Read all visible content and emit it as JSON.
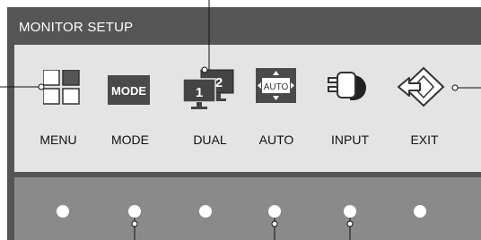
{
  "window": {
    "title": "MONITOR SETUP"
  },
  "menu_items": [
    {
      "label": "MENU",
      "icon": "menu-grid-icon"
    },
    {
      "label": "MODE",
      "icon": "mode-icon",
      "icon_text": "MODE"
    },
    {
      "label": "DUAL",
      "icon": "dual-monitor-icon",
      "icon_text_1": "1",
      "icon_text_2": "2"
    },
    {
      "label": "AUTO",
      "icon": "auto-adjust-icon",
      "icon_text": "AUTO"
    },
    {
      "label": "INPUT",
      "icon": "input-plug-icon"
    },
    {
      "label": "EXIT",
      "icon": "exit-arrow-icon"
    }
  ],
  "buttons": [
    "menu-button",
    "mode-button",
    "dual-button",
    "auto-button",
    "input-button",
    "exit-button"
  ],
  "colors": {
    "frame": "#555555",
    "panel": "#e4e4e4",
    "bezel": "#8a8a8a",
    "icon_dark": "#333333"
  }
}
